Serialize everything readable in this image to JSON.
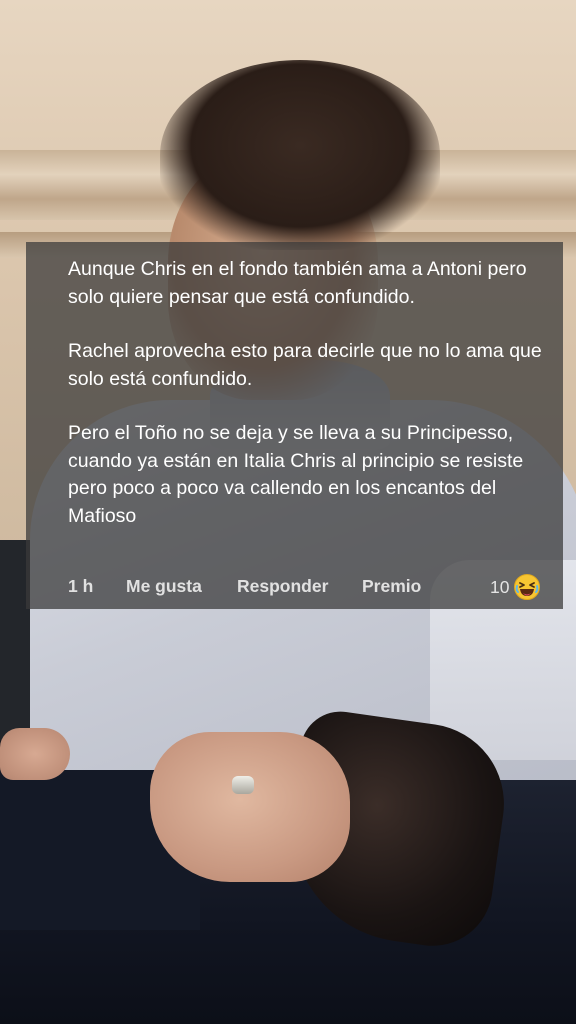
{
  "comment": {
    "paragraphs": [
      "Aunque Chris en el fondo también ama a Antoni pero solo quiere pensar que está confundido.",
      "Rachel aprovecha esto para decirle que no lo ama que solo está confundido.",
      "Pero el Toño no se deja y se lleva a su Principesso, cuando ya están en Italia Chris al principio se resiste pero poco a poco va callendo en los encantos del Mafioso"
    ],
    "timestamp": "1 h",
    "like_label": "Me gusta",
    "reply_label": "Responder",
    "award_label": "Premio",
    "reaction_count": "10",
    "reaction_icon": "laughing-emoji-icon"
  },
  "colors": {
    "overlay": "#3a3a3a",
    "text": "#ffffff",
    "action_text": "#e1e1e1",
    "emoji_yellow": "#f7c532"
  }
}
